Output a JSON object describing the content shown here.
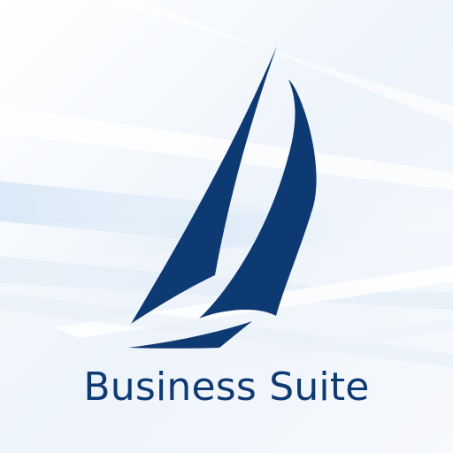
{
  "app": {
    "title": "Business Suite",
    "logo_icon": "sailboat-icon"
  },
  "colors": {
    "brand": "#0e3a74",
    "background": "#f4f7fb",
    "streak": "#dbe9f7"
  }
}
